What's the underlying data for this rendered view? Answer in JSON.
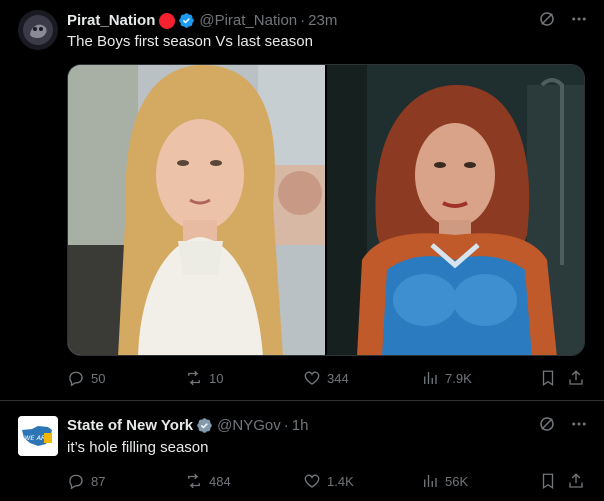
{
  "colors": {
    "background": "#000000",
    "text_primary": "#e7e9ea",
    "text_secondary": "#71767b",
    "divider": "#2f3336",
    "verified_blue": "#1d9bf0",
    "red_badge": "#f4212e",
    "gov_gray": "#829aab"
  },
  "tweets": [
    {
      "name": "Pirat_Nation",
      "handle": "@Pirat_Nation",
      "separator": "·",
      "time": "23m",
      "text": "The Boys first season Vs last season",
      "badges": [
        "red-circle-icon",
        "verified-badge-icon"
      ],
      "media": [
        "image-left-first-season",
        "image-right-last-season"
      ],
      "stats": {
        "replies": "50",
        "reposts": "10",
        "likes": "344",
        "views": "7.9K"
      }
    },
    {
      "name": "State of New York",
      "handle": "@NYGov",
      "separator": "·",
      "time": "1h",
      "text": "it’s hole filling season",
      "avatar_text": "WE ARE NY",
      "badges": [
        "government-badge-icon"
      ],
      "stats": {
        "replies": "87",
        "reposts": "484",
        "likes": "1.4K",
        "views": "56K"
      }
    }
  ]
}
